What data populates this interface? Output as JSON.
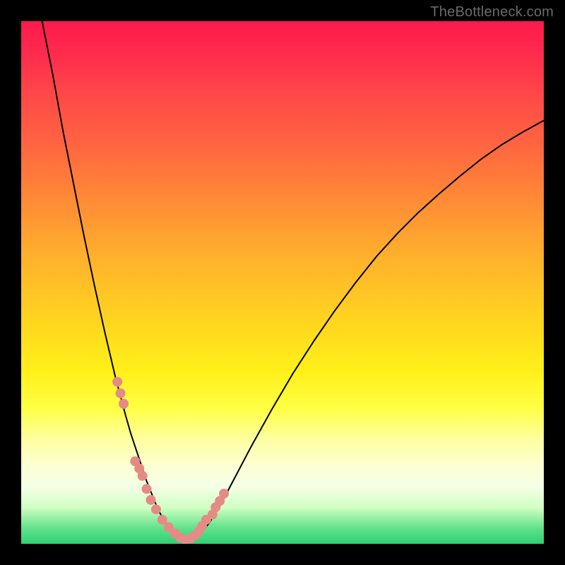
{
  "watermark": "TheBottleneck.com",
  "chart_data": {
    "type": "line",
    "title": "",
    "xlabel": "",
    "ylabel": "",
    "xlim": [
      0,
      100
    ],
    "ylim": [
      0,
      100
    ],
    "grid": false,
    "legend": false,
    "series": [
      {
        "name": "bottleneck-curve",
        "x": [
          4,
          6,
          8,
          10,
          12,
          14,
          16,
          18,
          20,
          21,
          22,
          23,
          24,
          25,
          26,
          27,
          28,
          29,
          30,
          32,
          34,
          36,
          38,
          40,
          44,
          48,
          52,
          56,
          60,
          64,
          68,
          72,
          76,
          80,
          84,
          88,
          92,
          96,
          100
        ],
        "values": [
          100,
          90,
          79,
          69,
          59,
          49.5,
          40.5,
          32,
          24.5,
          21,
          18,
          15,
          12,
          9.5,
          7,
          5,
          3.5,
          2.2,
          1.4,
          0.5,
          1.6,
          4,
          7.2,
          11,
          18.6,
          25.8,
          32.6,
          38.8,
          44.6,
          50,
          55,
          59.4,
          63.4,
          67,
          70.4,
          73.6,
          76.4,
          78.8,
          81
        ]
      }
    ],
    "highlight_points": {
      "name": "salmon-dots",
      "color": "#e58b86",
      "x": [
        18.4,
        19.0,
        19.6,
        21.8,
        22.6,
        23.2,
        24.0,
        24.8,
        25.8,
        27.0,
        28.2,
        29.4,
        30.4,
        31.4,
        32.4,
        33.2,
        34.0,
        34.6,
        35.4,
        36.6,
        37.2,
        38.0,
        38.8
      ],
      "values": [
        31.0,
        28.8,
        26.8,
        15.8,
        14.4,
        13.0,
        10.5,
        8.4,
        6.6,
        4.6,
        3.2,
        2.0,
        1.2,
        0.8,
        1.0,
        1.6,
        2.4,
        3.4,
        4.6,
        5.6,
        7.0,
        8.2,
        9.6
      ]
    }
  }
}
